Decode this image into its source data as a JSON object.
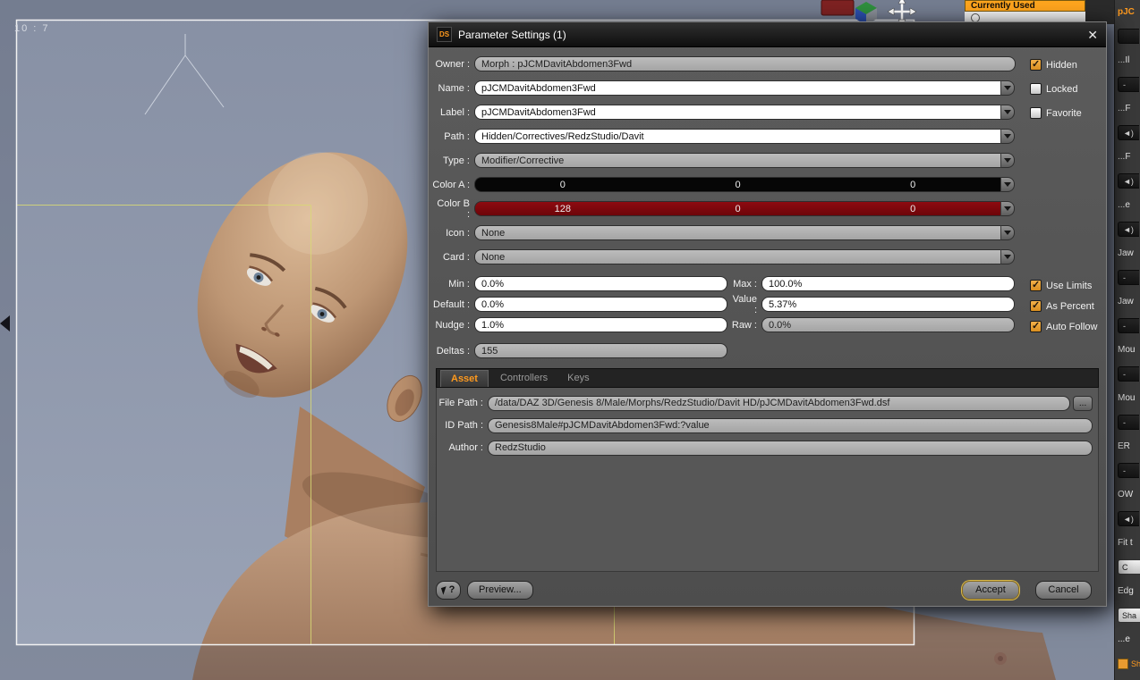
{
  "viewport": {
    "aspect_label": "10 : 7"
  },
  "currently_used_panel": {
    "header": "Currently Used"
  },
  "dialog": {
    "title": "Parameter Settings (1)",
    "app_icon": "DS",
    "fields": {
      "owner": {
        "label": "Owner :",
        "value": "Morph : pJCMDavitAbdomen3Fwd"
      },
      "name": {
        "label": "Name :",
        "value": "pJCMDavitAbdomen3Fwd"
      },
      "label": {
        "label": "Label :",
        "value": "pJCMDavitAbdomen3Fwd"
      },
      "path": {
        "label": "Path :",
        "value": "Hidden/Correctives/RedzStudio/Davit"
      },
      "type": {
        "label": "Type :",
        "value": "Modifier/Corrective"
      },
      "color_a": {
        "label": "Color A :",
        "r": "0",
        "g": "0",
        "b": "0",
        "hex": "#000000"
      },
      "color_b": {
        "label": "Color B :",
        "r": "128",
        "g": "0",
        "b": "0",
        "hex": "#7d060c"
      },
      "icon": {
        "label": "Icon :",
        "value": "None"
      },
      "card": {
        "label": "Card :",
        "value": "None"
      },
      "min": {
        "label": "Min :",
        "value": "0.0%"
      },
      "max": {
        "label": "Max :",
        "value": "100.0%"
      },
      "default": {
        "label": "Default :",
        "value": "0.0%"
      },
      "value": {
        "label": "Value :",
        "value": "5.37%"
      },
      "nudge": {
        "label": "Nudge :",
        "value": "1.0%"
      },
      "raw": {
        "label": "Raw :",
        "value": "0.0%"
      },
      "deltas": {
        "label": "Deltas :",
        "value": "155"
      }
    },
    "checkboxes": {
      "hidden": {
        "label": "Hidden",
        "checked": true
      },
      "locked": {
        "label": "Locked",
        "checked": false
      },
      "favorite": {
        "label": "Favorite",
        "checked": false
      },
      "use_limits": {
        "label": "Use Limits",
        "checked": true
      },
      "as_percent": {
        "label": "As Percent",
        "checked": true
      },
      "auto_follow": {
        "label": "Auto Follow",
        "checked": true
      }
    },
    "tabs": [
      {
        "label": "Asset",
        "active": true
      },
      {
        "label": "Controllers",
        "active": false
      },
      {
        "label": "Keys",
        "active": false
      }
    ],
    "asset": {
      "file_path": {
        "label": "File Path :",
        "value": "/data/DAZ 3D/Genesis 8/Male/Morphs/RedzStudio/Davit HD/pJCMDavitAbdomen3Fwd.dsf"
      },
      "id_path": {
        "label": "ID Path :",
        "value": "Genesis8Male#pJCMDavitAbdomen3Fwd:?value"
      },
      "author": {
        "label": "Author :",
        "value": "RedzStudio"
      },
      "browse_label": "..."
    },
    "buttons": {
      "help": "?",
      "preview": "Preview...",
      "accept": "Accept",
      "cancel": "Cancel"
    }
  },
  "right_panel": {
    "items": [
      {
        "kind": "label-orange",
        "text": "pJC"
      },
      {
        "kind": "slider",
        "text": ""
      },
      {
        "kind": "label",
        "text": "...Il"
      },
      {
        "kind": "slider",
        "text": "-"
      },
      {
        "kind": "label",
        "text": "...F"
      },
      {
        "kind": "slider-mute",
        "text": ""
      },
      {
        "kind": "label",
        "text": "...F"
      },
      {
        "kind": "slider-mute",
        "text": ""
      },
      {
        "kind": "label",
        "text": "...e"
      },
      {
        "kind": "slider-mute",
        "text": ""
      },
      {
        "kind": "label",
        "text": "Jaw"
      },
      {
        "kind": "slider",
        "text": "-"
      },
      {
        "kind": "label",
        "text": "Jaw"
      },
      {
        "kind": "slider",
        "text": "-"
      },
      {
        "kind": "label",
        "text": "Mou"
      },
      {
        "kind": "slider",
        "text": "-"
      },
      {
        "kind": "label",
        "text": "Mou"
      },
      {
        "kind": "slider",
        "text": "-"
      },
      {
        "kind": "label",
        "text": "ER"
      },
      {
        "kind": "slider",
        "text": "-"
      },
      {
        "kind": "label",
        "text": "OW"
      },
      {
        "kind": "slider-mute",
        "text": ""
      },
      {
        "kind": "label",
        "text": "Fit t"
      },
      {
        "kind": "button",
        "text": "C"
      },
      {
        "kind": "label",
        "text": "Edg"
      },
      {
        "kind": "button",
        "text": "Sha"
      },
      {
        "kind": "label",
        "text": "...e"
      },
      {
        "kind": "check-orange",
        "text": "Show"
      }
    ]
  },
  "colors": {
    "accent_orange": "#ff9a1e",
    "color_a_hex": "#000000",
    "color_b_hex": "#7d060c"
  }
}
